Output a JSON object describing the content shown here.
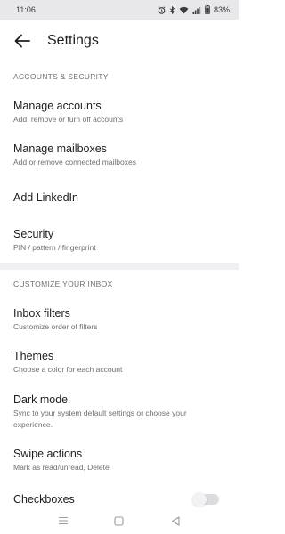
{
  "status_bar": {
    "time": "11:06",
    "battery": "83%",
    "icons": [
      "alarm-icon",
      "bluetooth-icon",
      "wifi-icon",
      "signal-icon",
      "battery-icon"
    ]
  },
  "header": {
    "title": "Settings",
    "back_icon": "arrow-left-icon"
  },
  "sections": [
    {
      "header": "ACCOUNTS & SECURITY",
      "items": [
        {
          "title": "Manage accounts",
          "subtitle": "Add, remove or turn off accounts"
        },
        {
          "title": "Manage mailboxes",
          "subtitle": "Add or remove connected mailboxes"
        },
        {
          "title": "Add LinkedIn",
          "subtitle": ""
        },
        {
          "title": "Security",
          "subtitle": "PIN / pattern / fingerprint"
        }
      ]
    },
    {
      "header": "CUSTOMIZE YOUR INBOX",
      "items": [
        {
          "title": "Inbox filters",
          "subtitle": "Customize order of filters"
        },
        {
          "title": "Themes",
          "subtitle": "Choose a color for each account"
        },
        {
          "title": "Dark mode",
          "subtitle": "Sync to your system default settings or choose your experience."
        },
        {
          "title": "Swipe actions",
          "subtitle": "Mark as read/unread, Delete"
        },
        {
          "title": "Checkboxes",
          "subtitle": "",
          "toggle": false
        }
      ]
    }
  ],
  "nav_bar": {
    "icons": [
      "recents-icon",
      "home-icon",
      "back-triangle-icon"
    ]
  },
  "colors": {
    "background": "#ffffff",
    "status_bar": "#e8e8ea",
    "section_band": "#f0f0f2",
    "secondary_text": "#6e6e73"
  }
}
